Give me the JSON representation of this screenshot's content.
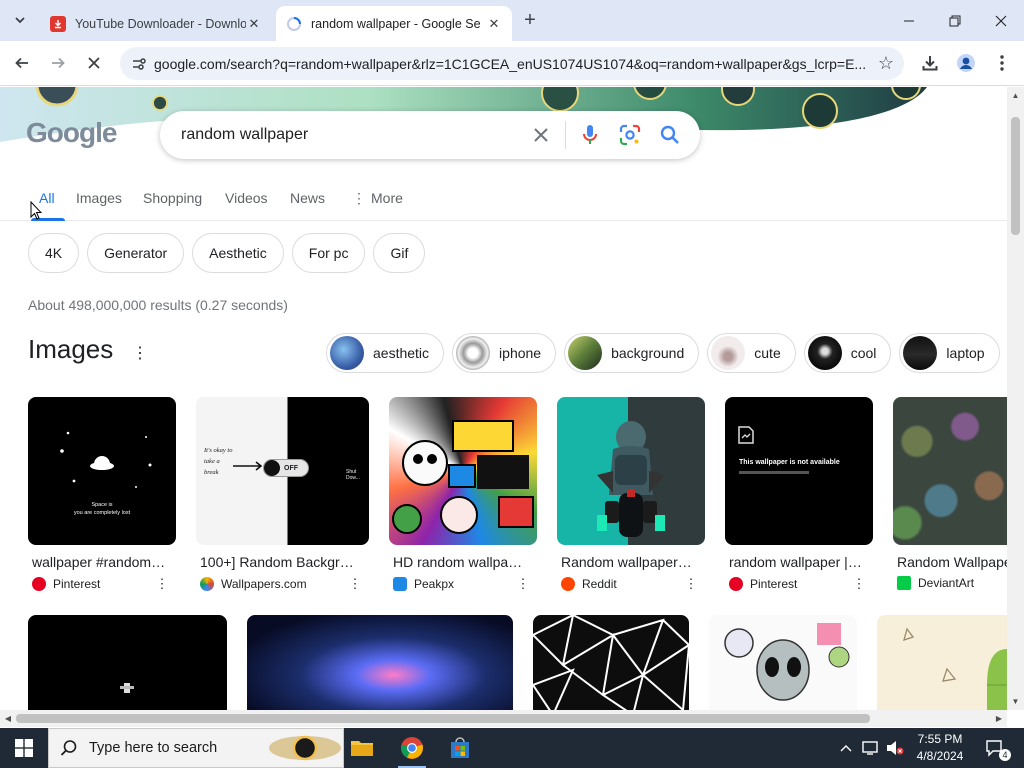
{
  "colors": {
    "accent": "#1a73e8",
    "tabstrip": "#dfe6f5",
    "taskbar": "#1f2a36"
  },
  "browser": {
    "tabs": [
      {
        "title": "YouTube Downloader - Downlo",
        "icon": "youtube-downloader-icon",
        "active": false
      },
      {
        "title": "random wallpaper - Google Se",
        "icon": "loading-spinner-icon",
        "active": true
      }
    ],
    "url": "google.com/search?q=random+wallpaper&rlz=1C1GCEA_enUS1074US1074&oq=random+wallpaper&gs_lcrp=E..."
  },
  "search": {
    "logo": "Google",
    "query": "random wallpaper",
    "nav": [
      "All",
      "Images",
      "Shopping",
      "Videos",
      "News",
      "More"
    ],
    "chips": [
      "4K",
      "Generator",
      "Aesthetic",
      "For pc",
      "Gif"
    ],
    "stats": "About 498,000,000 results (0.27 seconds)"
  },
  "images": {
    "heading": "Images",
    "related": [
      "aesthetic",
      "iphone",
      "background",
      "cute",
      "cool",
      "laptop"
    ],
    "results": [
      {
        "caption": "wallpaper #random ...",
        "source": "Pinterest"
      },
      {
        "caption": "100+] Random Backgrou...",
        "source": "Wallpapers.com"
      },
      {
        "caption": "HD random wallpap...",
        "source": "Peakpx"
      },
      {
        "caption": "Random wallpapers! ...",
        "source": "Reddit"
      },
      {
        "caption": "random wallpaper | T...",
        "source": "Pinterest"
      },
      {
        "caption": "Random Wallpape...",
        "source": "DeviantArt"
      }
    ],
    "thumb_text": {
      "quote1": "Space is",
      "quote2": "you are completely lost",
      "quote3": "It's okay to take a break",
      "toggle": "OFF",
      "shutdown": "Shut Dow...",
      "unavailable": "This wallpaper is not available"
    }
  },
  "taskbar": {
    "search_placeholder": "Type here to search",
    "time": "7:55 PM",
    "date": "4/8/2024",
    "notification_count": "4"
  }
}
